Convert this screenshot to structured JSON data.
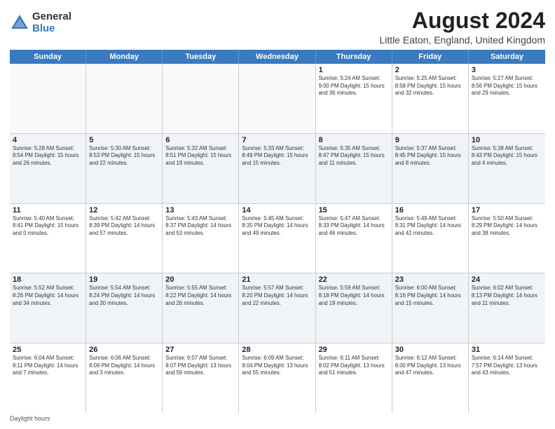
{
  "logo": {
    "general": "General",
    "blue": "Blue"
  },
  "title": "August 2024",
  "subtitle": "Little Eaton, England, United Kingdom",
  "header_days": [
    "Sunday",
    "Monday",
    "Tuesday",
    "Wednesday",
    "Thursday",
    "Friday",
    "Saturday"
  ],
  "footer": "Daylight hours",
  "weeks": [
    [
      {
        "day": "",
        "info": "",
        "empty": true
      },
      {
        "day": "",
        "info": "",
        "empty": true
      },
      {
        "day": "",
        "info": "",
        "empty": true
      },
      {
        "day": "",
        "info": "",
        "empty": true
      },
      {
        "day": "1",
        "info": "Sunrise: 5:24 AM\nSunset: 9:00 PM\nDaylight: 15 hours\nand 36 minutes."
      },
      {
        "day": "2",
        "info": "Sunrise: 5:25 AM\nSunset: 8:58 PM\nDaylight: 15 hours\nand 32 minutes."
      },
      {
        "day": "3",
        "info": "Sunrise: 5:27 AM\nSunset: 8:56 PM\nDaylight: 15 hours\nand 29 minutes."
      }
    ],
    [
      {
        "day": "4",
        "info": "Sunrise: 5:28 AM\nSunset: 8:54 PM\nDaylight: 15 hours\nand 26 minutes."
      },
      {
        "day": "5",
        "info": "Sunrise: 5:30 AM\nSunset: 8:53 PM\nDaylight: 15 hours\nand 22 minutes."
      },
      {
        "day": "6",
        "info": "Sunrise: 5:32 AM\nSunset: 8:51 PM\nDaylight: 15 hours\nand 19 minutes."
      },
      {
        "day": "7",
        "info": "Sunrise: 5:33 AM\nSunset: 8:49 PM\nDaylight: 15 hours\nand 15 minutes."
      },
      {
        "day": "8",
        "info": "Sunrise: 5:35 AM\nSunset: 8:47 PM\nDaylight: 15 hours\nand 11 minutes."
      },
      {
        "day": "9",
        "info": "Sunrise: 5:37 AM\nSunset: 8:45 PM\nDaylight: 15 hours\nand 8 minutes."
      },
      {
        "day": "10",
        "info": "Sunrise: 5:38 AM\nSunset: 8:43 PM\nDaylight: 15 hours\nand 4 minutes."
      }
    ],
    [
      {
        "day": "11",
        "info": "Sunrise: 5:40 AM\nSunset: 8:41 PM\nDaylight: 15 hours\nand 0 minutes."
      },
      {
        "day": "12",
        "info": "Sunrise: 5:42 AM\nSunset: 8:39 PM\nDaylight: 14 hours\nand 57 minutes."
      },
      {
        "day": "13",
        "info": "Sunrise: 5:43 AM\nSunset: 8:37 PM\nDaylight: 14 hours\nand 53 minutes."
      },
      {
        "day": "14",
        "info": "Sunrise: 5:45 AM\nSunset: 8:35 PM\nDaylight: 14 hours\nand 49 minutes."
      },
      {
        "day": "15",
        "info": "Sunrise: 5:47 AM\nSunset: 8:33 PM\nDaylight: 14 hours\nand 46 minutes."
      },
      {
        "day": "16",
        "info": "Sunrise: 5:49 AM\nSunset: 8:31 PM\nDaylight: 14 hours\nand 42 minutes."
      },
      {
        "day": "17",
        "info": "Sunrise: 5:50 AM\nSunset: 8:29 PM\nDaylight: 14 hours\nand 38 minutes."
      }
    ],
    [
      {
        "day": "18",
        "info": "Sunrise: 5:52 AM\nSunset: 8:26 PM\nDaylight: 14 hours\nand 34 minutes."
      },
      {
        "day": "19",
        "info": "Sunrise: 5:54 AM\nSunset: 8:24 PM\nDaylight: 14 hours\nand 30 minutes."
      },
      {
        "day": "20",
        "info": "Sunrise: 5:55 AM\nSunset: 8:22 PM\nDaylight: 14 hours\nand 26 minutes."
      },
      {
        "day": "21",
        "info": "Sunrise: 5:57 AM\nSunset: 8:20 PM\nDaylight: 14 hours\nand 22 minutes."
      },
      {
        "day": "22",
        "info": "Sunrise: 5:59 AM\nSunset: 8:18 PM\nDaylight: 14 hours\nand 19 minutes."
      },
      {
        "day": "23",
        "info": "Sunrise: 6:00 AM\nSunset: 8:16 PM\nDaylight: 14 hours\nand 15 minutes."
      },
      {
        "day": "24",
        "info": "Sunrise: 6:02 AM\nSunset: 8:13 PM\nDaylight: 14 hours\nand 11 minutes."
      }
    ],
    [
      {
        "day": "25",
        "info": "Sunrise: 6:04 AM\nSunset: 8:11 PM\nDaylight: 14 hours\nand 7 minutes."
      },
      {
        "day": "26",
        "info": "Sunrise: 6:06 AM\nSunset: 8:09 PM\nDaylight: 14 hours\nand 3 minutes."
      },
      {
        "day": "27",
        "info": "Sunrise: 6:07 AM\nSunset: 8:07 PM\nDaylight: 13 hours\nand 59 minutes."
      },
      {
        "day": "28",
        "info": "Sunrise: 6:09 AM\nSunset: 8:04 PM\nDaylight: 13 hours\nand 55 minutes."
      },
      {
        "day": "29",
        "info": "Sunrise: 6:11 AM\nSunset: 8:02 PM\nDaylight: 13 hours\nand 51 minutes."
      },
      {
        "day": "30",
        "info": "Sunrise: 6:12 AM\nSunset: 8:00 PM\nDaylight: 13 hours\nand 47 minutes."
      },
      {
        "day": "31",
        "info": "Sunrise: 6:14 AM\nSunset: 7:57 PM\nDaylight: 13 hours\nand 43 minutes."
      }
    ]
  ]
}
